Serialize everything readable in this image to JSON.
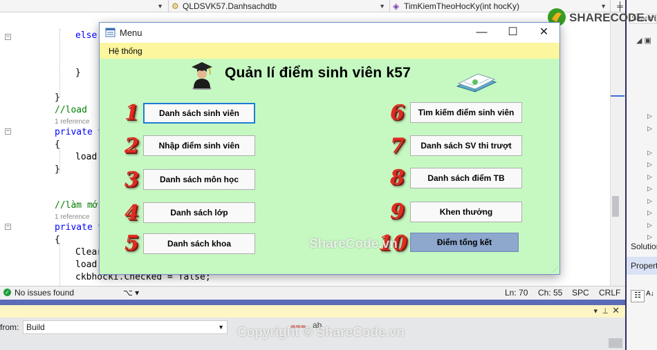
{
  "ide": {
    "dropdown1": "QLDSVK57.Danhsachdtb",
    "dropdown2": "TimKiemTheoHocKy(int hocKy)",
    "search_placeholder": "Search",
    "code": {
      "else": "else",
      "comment_load": "//load",
      "ref": "1 reference",
      "private_v": "private v",
      "load_call": "load(",
      "comment_refresh": "//làm mới",
      "clear": "Clear",
      "ckb_line": "ckbhocki.Checked = false;",
      "ckb_partial": "ckbhocki.Checked = fa"
    },
    "status": {
      "issues": "No issues found",
      "ln": "Ln: 70",
      "ch": "Ch: 55",
      "spc": "SPC",
      "crlf": "CRLF"
    },
    "output": {
      "from_label": "from:",
      "build": "Build"
    },
    "right_panel": {
      "solution": "Solution",
      "properties": "Propert"
    }
  },
  "window": {
    "title": "Menu",
    "menu": "Hệ thống",
    "app_title": "Quản  lí điểm sinh viên k57",
    "left_buttons": [
      {
        "num": "1",
        "label": "Danh sách sinh viên"
      },
      {
        "num": "2",
        "label": "Nhập điểm  sinh viên"
      },
      {
        "num": "3",
        "label": "Danh sách môn học"
      },
      {
        "num": "4",
        "label": "Danh sách lớp"
      },
      {
        "num": "5",
        "label": "Danh sách khoa"
      }
    ],
    "right_buttons": [
      {
        "num": "6",
        "label": "Tìm kiếm điểm sinh viên"
      },
      {
        "num": "7",
        "label": "Danh sách SV thi trượt"
      },
      {
        "num": "8",
        "label": "Danh sách điểm TB"
      },
      {
        "num": "9",
        "label": "Khen thưởng"
      },
      {
        "num": "10",
        "label": "Điểm tổng kết"
      }
    ]
  },
  "watermarks": {
    "center": "ShareCode.vn",
    "bottom": "Copyright © ShareCode.vn",
    "logo": "SHARECODE.vn"
  },
  "colors": {
    "form_bg": "#c6f9c2",
    "menu_bg": "#fcf69e",
    "number_red": "#e02b20",
    "selected_button": "#8da7cd"
  }
}
